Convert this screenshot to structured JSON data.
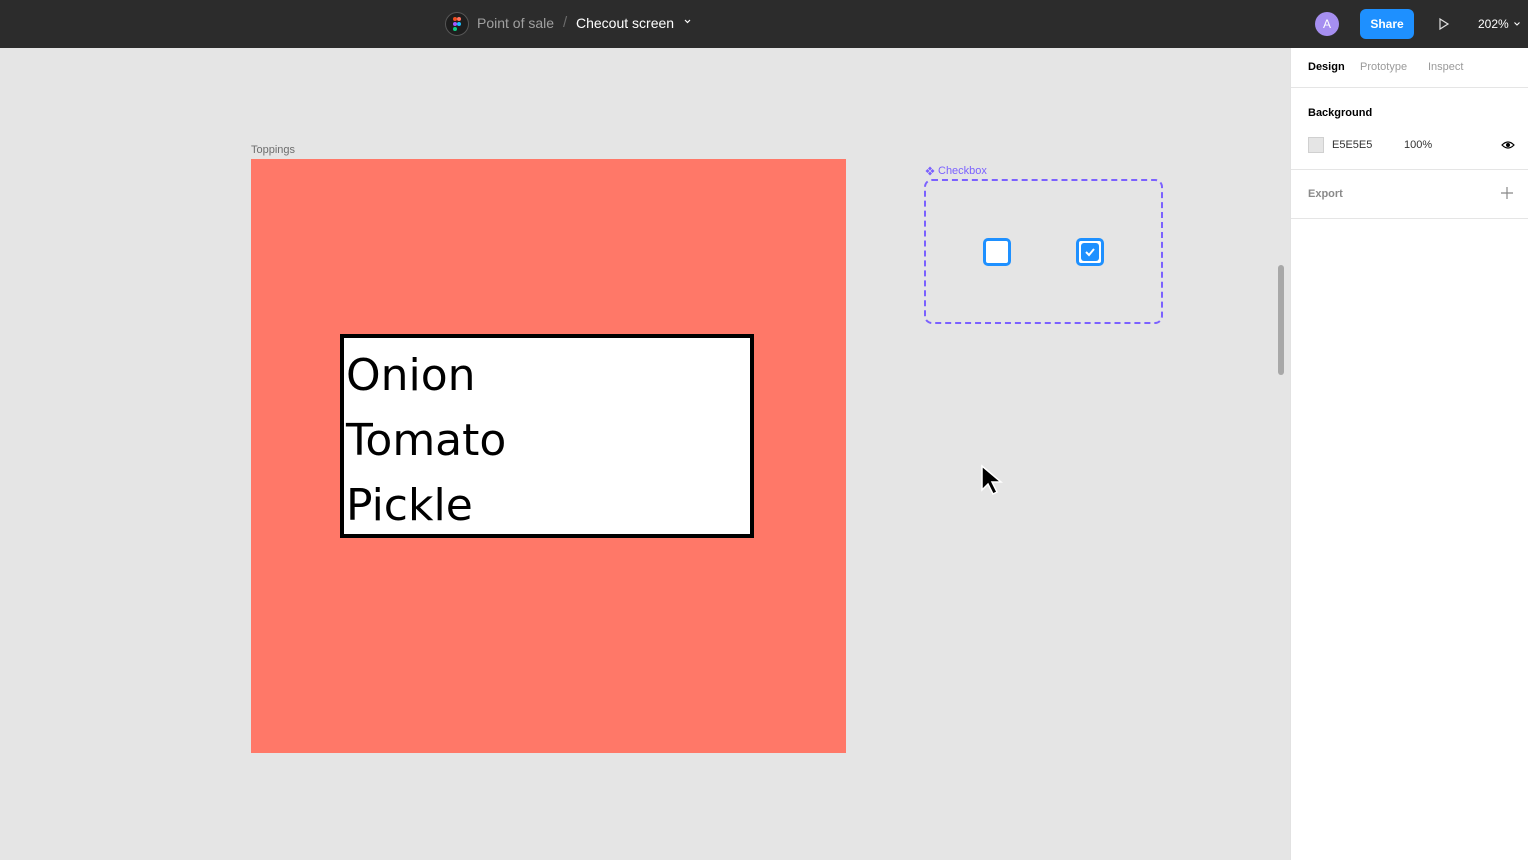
{
  "topbar": {
    "project": "Point of sale",
    "separator": "/",
    "file": "Checout screen",
    "avatar_initial": "A",
    "share_label": "Share",
    "zoom": "202%"
  },
  "canvas": {
    "frame_label": "Toppings",
    "frame_color": "#FF7868",
    "toppings": [
      "Onion",
      "Tomato",
      "Pickle"
    ],
    "component_label": "Checkbox",
    "checkboxes": [
      {
        "checked": false
      },
      {
        "checked": true
      }
    ]
  },
  "panel": {
    "tabs": [
      "Design",
      "Prototype",
      "Inspect"
    ],
    "active_tab": "Design",
    "background_title": "Background",
    "background_hex": "E5E5E5",
    "background_opacity": "100%",
    "export_title": "Export"
  },
  "colors": {
    "accent": "#1E90FF",
    "component": "#7B61FF",
    "topbar": "#2C2C2C"
  },
  "icons": [
    "figma-logo-icon",
    "chevron-down-icon",
    "play-icon",
    "component-icon",
    "checkbox-unchecked-icon",
    "checkbox-checked-icon",
    "cursor-icon",
    "eye-icon",
    "plus-icon"
  ]
}
